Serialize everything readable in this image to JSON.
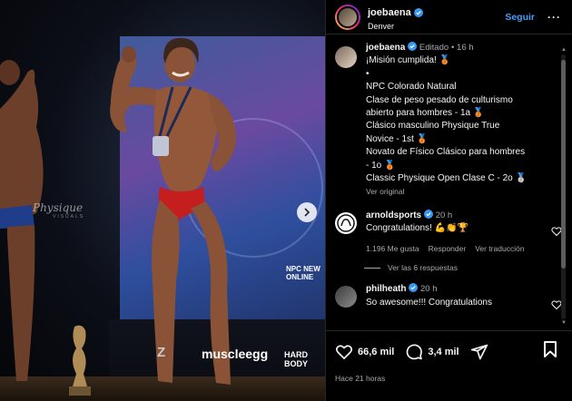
{
  "post": {
    "author": "joebaena",
    "location": "Denver",
    "follow_label": "Seguir",
    "more_label": "···"
  },
  "photo": {
    "watermark": "Physique",
    "watermark_sub": "VISUALS",
    "backdrop_text": "NPC NEW\nONLINE",
    "sponsors": [
      "muscleegg",
      "HARD BODY"
    ]
  },
  "caption": {
    "username": "joebaena",
    "edited": "Editado",
    "dot": "•",
    "time": "16 h",
    "lines": [
      "¡Misión cumplida! 🥉",
      "•",
      "NPC Colorado Natural",
      "Clase de peso pesado de culturismo",
      "abierto para hombres - 1a 🥉",
      "Clásico masculino Physique True",
      "Novice - 1st 🥉",
      "Novato de Físico Clásico para hombres",
      "- 1o 🥉",
      "Classic Physique Open Clase C - 2o 🥈"
    ],
    "see_original": "Ver original"
  },
  "comments": [
    {
      "username": "arnoldsports",
      "time": "20 h",
      "text": "Congratulations! 💪👏🏆",
      "likes": "1.196 Me gusta",
      "reply": "Responder",
      "translate": "Ver traducción",
      "view_replies": "Ver las 6 respuestas"
    },
    {
      "username": "philheath",
      "time": "20 h",
      "text": "So awesome!!! Congratulations"
    }
  ],
  "actions": {
    "likes": "66,6 mil",
    "comments": "3,4 mil",
    "time_ago": "Hace 21 horas"
  },
  "colors": {
    "link": "#4a9cf5",
    "verified": "#3897f0",
    "muted": "#a8a8a8"
  }
}
